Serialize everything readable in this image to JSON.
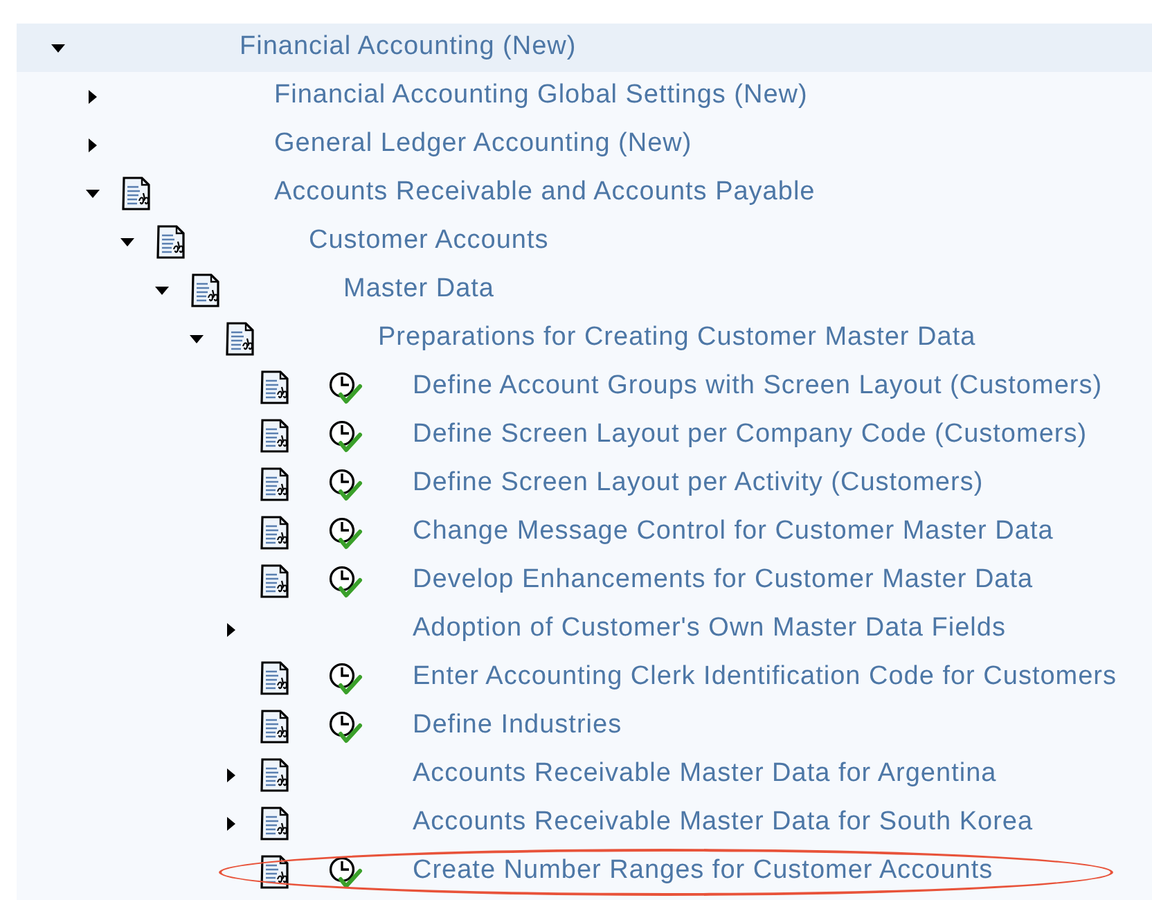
{
  "tree": [
    {
      "label": "Financial Accounting (New)",
      "kind": "group",
      "expanded": true,
      "selected": true,
      "circled": false,
      "children": [
        {
          "label": "Financial Accounting Global Settings (New)",
          "kind": "group",
          "expanded": false,
          "selected": false,
          "circled": false
        },
        {
          "label": "General Ledger Accounting (New)",
          "kind": "group",
          "expanded": false,
          "selected": false,
          "circled": false
        },
        {
          "label": "Accounts Receivable and Accounts Payable",
          "kind": "document_group",
          "expanded": true,
          "selected": false,
          "circled": false,
          "children": [
            {
              "label": "Customer Accounts",
              "kind": "document_group",
              "expanded": true,
              "selected": false,
              "circled": false,
              "children": [
                {
                  "label": "Master Data",
                  "kind": "document_group",
                  "expanded": true,
                  "selected": false,
                  "circled": false,
                  "children": [
                    {
                      "label": "Preparations for Creating Customer Master Data",
                      "kind": "document_group",
                      "expanded": true,
                      "selected": false,
                      "circled": false,
                      "children": [
                        {
                          "label": "Define Account Groups with Screen Layout (Customers)",
                          "kind": "activity",
                          "selected": false,
                          "circled": false
                        },
                        {
                          "label": "Define Screen Layout per Company Code (Customers)",
                          "kind": "activity",
                          "selected": false,
                          "circled": false
                        },
                        {
                          "label": "Define Screen Layout per Activity (Customers)",
                          "kind": "activity",
                          "selected": false,
                          "circled": false
                        },
                        {
                          "label": "Change Message Control for Customer Master Data",
                          "kind": "activity",
                          "selected": false,
                          "circled": false
                        },
                        {
                          "label": "Develop Enhancements for Customer Master Data",
                          "kind": "activity",
                          "selected": false,
                          "circled": false
                        },
                        {
                          "label": "Adoption of Customer's Own Master Data Fields",
                          "kind": "group",
                          "expanded": false,
                          "selected": false,
                          "circled": false
                        },
                        {
                          "label": "Enter Accounting Clerk Identification Code for Customers",
                          "kind": "activity",
                          "selected": false,
                          "circled": false
                        },
                        {
                          "label": "Define Industries",
                          "kind": "activity",
                          "selected": false,
                          "circled": false
                        },
                        {
                          "label": "Accounts Receivable Master Data for Argentina",
                          "kind": "document_group",
                          "expanded": false,
                          "selected": false,
                          "circled": false
                        },
                        {
                          "label": "Accounts Receivable Master Data for South Korea",
                          "kind": "document_group",
                          "expanded": false,
                          "selected": false,
                          "circled": false
                        },
                        {
                          "label": "Create Number Ranges for Customer Accounts",
                          "kind": "activity",
                          "selected": false,
                          "circled": true
                        }
                      ]
                    }
                  ]
                }
              ]
            }
          ]
        }
      ]
    }
  ]
}
